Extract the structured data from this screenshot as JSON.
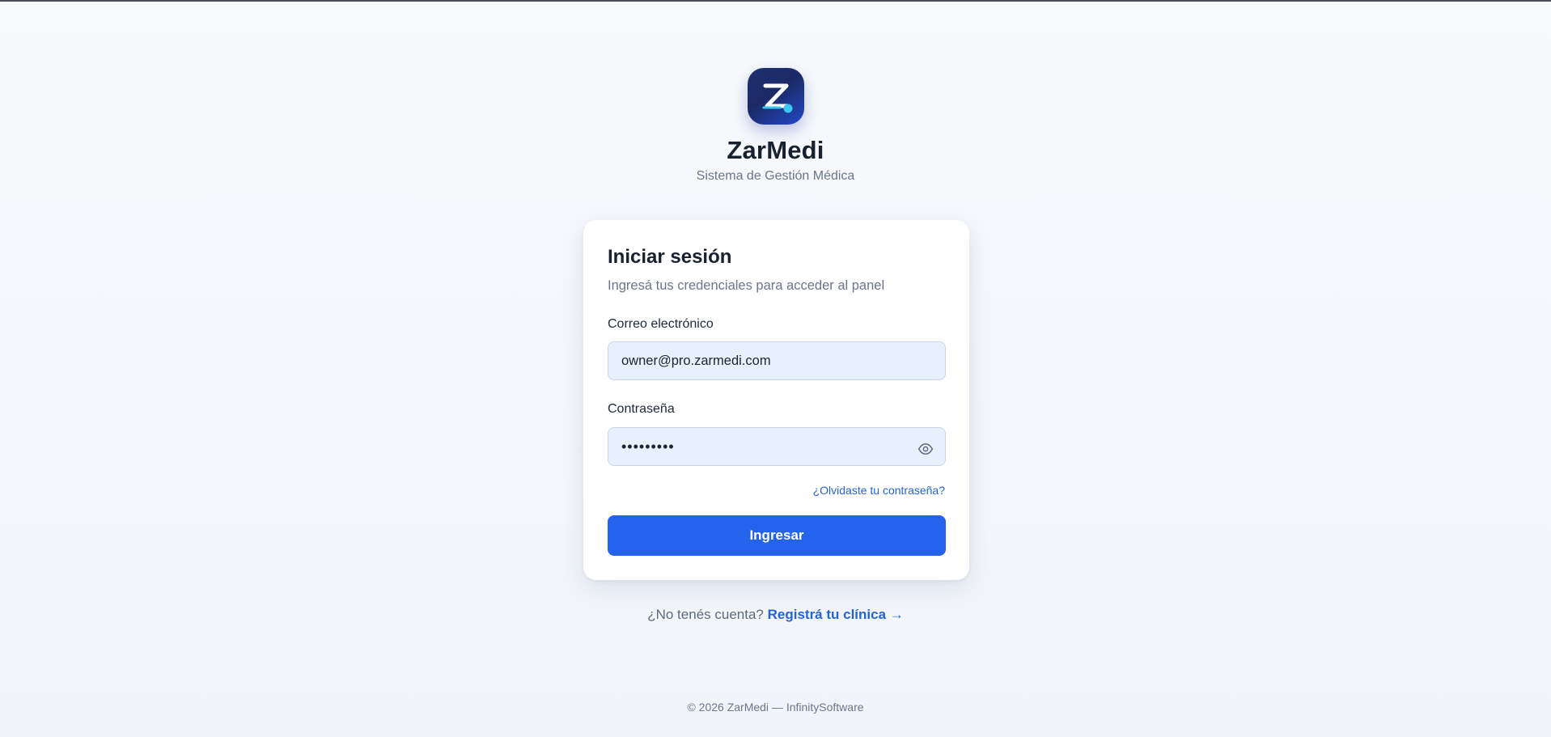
{
  "brand": {
    "name": "ZarMedi",
    "subtitle": "Sistema de Gestión Médica",
    "logo_letter": "Z",
    "logo_icon": "zarmedi-logo-icon"
  },
  "login": {
    "title": "Iniciar sesión",
    "description": "Ingresá tus credenciales para acceder al panel",
    "email_label": "Correo electrónico",
    "email_value": "owner@pro.zarmedi.com",
    "password_label": "Contraseña",
    "password_value": "•••••••••",
    "password_toggle_icon": "eye-icon",
    "forgot_link": "¿Olvidaste tu contraseña?",
    "submit_label": "Ingresar"
  },
  "register": {
    "prompt": "¿No tenés cuenta?",
    "link": "Registrá tu clínica →"
  },
  "footer": {
    "text": "© 2026 ZarMedi — InfinitySoftware"
  },
  "colors": {
    "primary": "#2463eb",
    "link": "#2563d8",
    "input_background": "#e8f0fe",
    "page_background": "#f4f7fb",
    "logo_background": "#1f2f72",
    "logo_accent": "#3cc6f2"
  }
}
